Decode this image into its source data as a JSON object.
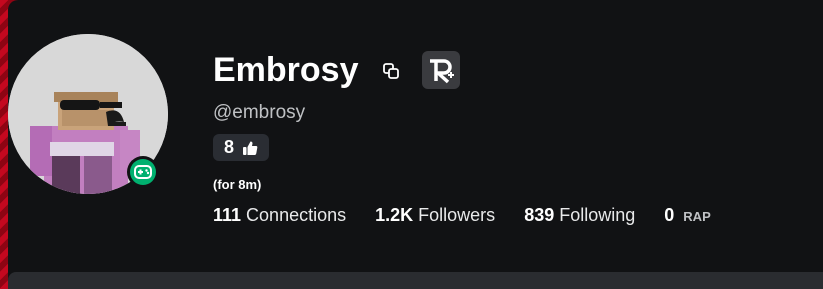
{
  "profile": {
    "display_name": "Embrosy",
    "username": "@embrosy",
    "likes": "8",
    "duration": "(for 8m)",
    "status": "playing"
  },
  "stats": {
    "connections_count": "111",
    "connections_label": "Connections",
    "followers_count": "1.2K",
    "followers_label": "Followers",
    "following_count": "839",
    "following_label": "Following",
    "rap_count": "0",
    "rap_label": "RAP"
  },
  "icons": {
    "copy": "copy-icon",
    "rolimons": "rolimons-icon",
    "thumbs_up": "thumbs-up-icon",
    "status": "gamepad-icon"
  },
  "colors": {
    "background": "#111214",
    "accent_green": "#00b06f",
    "chip": "#2a2d33",
    "border_red": "#c4081f"
  }
}
